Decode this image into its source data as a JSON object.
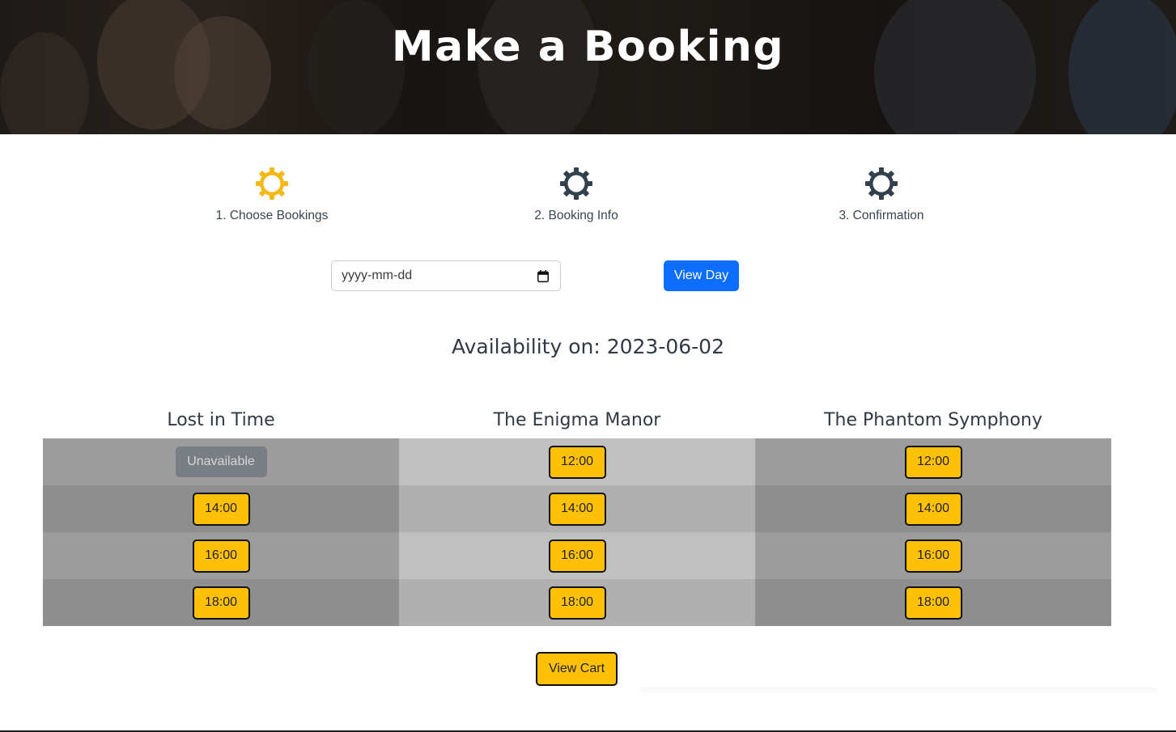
{
  "hero": {
    "title": "Make a Booking"
  },
  "steps": [
    {
      "label": "1. Choose Bookings",
      "icon": "gear-icon",
      "color": "#f5b815",
      "active": true
    },
    {
      "label": "2. Booking Info",
      "icon": "gear-icon",
      "color": "#33404d",
      "active": false
    },
    {
      "label": "3. Confirmation",
      "icon": "gear-icon",
      "color": "#33404d",
      "active": false
    }
  ],
  "date_picker": {
    "placeholder": "yyyy-mm-dd",
    "icon": "calendar-icon"
  },
  "view_day_label": "View Day",
  "availability_heading": "Availability on: 2023-06-02",
  "rooms": [
    {
      "name": "Lost in Time",
      "slots": [
        {
          "label": "Unavailable",
          "available": false
        },
        {
          "label": "14:00",
          "available": true
        },
        {
          "label": "16:00",
          "available": true
        },
        {
          "label": "18:00",
          "available": true
        }
      ]
    },
    {
      "name": "The Enigma Manor",
      "slots": [
        {
          "label": "12:00",
          "available": true
        },
        {
          "label": "14:00",
          "available": true
        },
        {
          "label": "16:00",
          "available": true
        },
        {
          "label": "18:00",
          "available": true
        }
      ]
    },
    {
      "name": "The Phantom Symphony",
      "slots": [
        {
          "label": "12:00",
          "available": true
        },
        {
          "label": "14:00",
          "available": true
        },
        {
          "label": "16:00",
          "available": true
        },
        {
          "label": "18:00",
          "available": true
        }
      ]
    }
  ],
  "view_cart_label": "View Cart",
  "colors": {
    "accent_yellow": "#ffc107",
    "primary_blue": "#0d6efd",
    "unavailable_gray": "#6c757d",
    "heading_text": "#2f3a46"
  }
}
